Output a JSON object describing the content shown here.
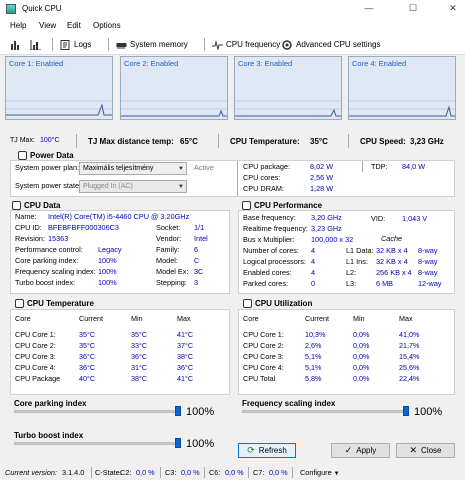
{
  "window": {
    "title": "Quick CPU",
    "min": "—",
    "max": "☐",
    "close": "✕"
  },
  "menu": [
    "Help",
    "View",
    "Edit",
    "Options"
  ],
  "toolbar": {
    "logs": "Logs",
    "system_memory": "System memory",
    "cpu_frequency": "CPU frequency",
    "advanced": "Advanced CPU settings"
  },
  "cores": [
    "Core 1: Enabled",
    "Core 2: Enabled",
    "Core 3: Enabled",
    "Core 4: Enabled"
  ],
  "info": {
    "tjmax_label": "TJ Max:",
    "tjmax_value": "100°C",
    "tjdist_label": "TJ Max distance temp:",
    "tjdist_value": "65°C",
    "temp_label": "CPU Temperature:",
    "temp_value": "35°C",
    "speed_label": "CPU Speed:",
    "speed_value": "3,23 GHz"
  },
  "power": {
    "title": "Power Data",
    "plan_label": "System power plan:",
    "plan_value": "Maximális teljesítmény",
    "plan_status": "Active",
    "state_label": "System power state:",
    "state_value": "Plugged In (AC)",
    "package_label": "CPU package:",
    "package_value": "8,02 W",
    "tdp_label": "TDP:",
    "tdp_value": "84,0 W",
    "cores_label": "CPU cores:",
    "cores_value": "2,56 W",
    "dram_label": "CPU DRAM:",
    "dram_value": "1,28 W"
  },
  "cpu_data": {
    "title": "CPU Data",
    "name_label": "Name:",
    "name_value": "Intel(R) Core(TM) i5-4460  CPU @ 3.20GHz",
    "id_label": "CPU ID:",
    "id_value": "BFEBFBFF000306C3",
    "socket_label": "Socket:",
    "socket_value": "1/1",
    "rev_label": "Revision:",
    "rev_value": "15363",
    "vendor_label": "Vendor:",
    "vendor_value": "Intel",
    "pc_label": "Performance control:",
    "pc_value": "Legacy",
    "family_label": "Family:",
    "family_value": "6",
    "cpi_label": "Core parking index:",
    "cpi_value": "100%",
    "model_label": "Model:",
    "model_value": "C",
    "fsi_label": "Frequency scaling index:",
    "fsi_value": "100%",
    "modelex_label": "Model Ex:",
    "modelex_value": "3C",
    "tbi_label": "Turbo boost index:",
    "tbi_value": "100%",
    "stepping_label": "Stepping:",
    "stepping_value": "3"
  },
  "cpu_perf": {
    "title": "CPU Performance",
    "base_label": "Base frequency:",
    "base_value": "3,20 GHz",
    "vid_label": "VID:",
    "vid_value": "1,043 V",
    "real_label": "Realtime frequency:",
    "real_value": "3,23 GHz",
    "bus_label": "Bus x Multiplier:",
    "bus_value": "100,000 x 32",
    "cache_label": "Cache",
    "rows": [
      {
        "l": "Number of cores:",
        "v": "4",
        "cl": "L1 Data:",
        "cv": "32 KB x 4",
        "cw": "8-way"
      },
      {
        "l": "Logical processors:",
        "v": "4",
        "cl": "L1 Ins:",
        "cv": "32 KB x 4",
        "cw": "8-way"
      },
      {
        "l": "Enabled cores:",
        "v": "4",
        "cl": "L2:",
        "cv": "256 KB x 4",
        "cw": "8-way"
      },
      {
        "l": "Parked cores:",
        "v": "0",
        "cl": "L3:",
        "cv": "6 MB",
        "cw": "12-way"
      }
    ]
  },
  "temp": {
    "title": "CPU Temperature",
    "headers": [
      "Core",
      "Current",
      "Min",
      "Max"
    ],
    "rows": [
      [
        "CPU Core 1:",
        "35°C",
        "35°C",
        "41°C"
      ],
      [
        "CPU Core 2:",
        "35°C",
        "33°C",
        "37°C"
      ],
      [
        "CPU Core 3:",
        "36°C",
        "36°C",
        "38°C"
      ],
      [
        "CPU Core 4:",
        "36°C",
        "31°C",
        "36°C"
      ],
      [
        "CPU Package",
        "40°C",
        "38°C",
        "41°C"
      ]
    ]
  },
  "util": {
    "title": "CPU Utilization",
    "headers": [
      "Core",
      "Current",
      "Min",
      "Max"
    ],
    "rows": [
      [
        "CPU Core 1:",
        "10,3%",
        "0,0%",
        "41,0%"
      ],
      [
        "CPU Core 2:",
        "2,6%",
        "0,0%",
        "21,7%"
      ],
      [
        "CPU Core 3:",
        "5,1%",
        "0,0%",
        "15,4%"
      ],
      [
        "CPU Core 4:",
        "5,1%",
        "0,0%",
        "25,6%"
      ],
      [
        "CPU Total",
        "5,8%",
        "0,0%",
        "22,4%"
      ]
    ]
  },
  "sliders": {
    "cpi_label": "Core parking index",
    "cpi_value": "100%",
    "cpi_level": 1.0,
    "tbi_label": "Turbo boost index",
    "tbi_value": "100%",
    "tbi_level": 1.0,
    "fsi_label": "Frequency scaling index",
    "fsi_value": "100%",
    "fsi_level": 1.0
  },
  "buttons": {
    "refresh": "Refresh",
    "apply": "Apply",
    "close": "Close"
  },
  "status": {
    "version_label": "Current version:",
    "version_value": "3.1.4.0",
    "cstate_label": "C-State:",
    "c2_label": "C2:",
    "c2_value": "0,0 %",
    "c3_label": "C3:",
    "c3_value": "0,0 %",
    "c6_label": "C6:",
    "c6_value": "0,0 %",
    "c7_label": "C7:",
    "c7_value": "0,0 %",
    "configure": "Configure"
  }
}
